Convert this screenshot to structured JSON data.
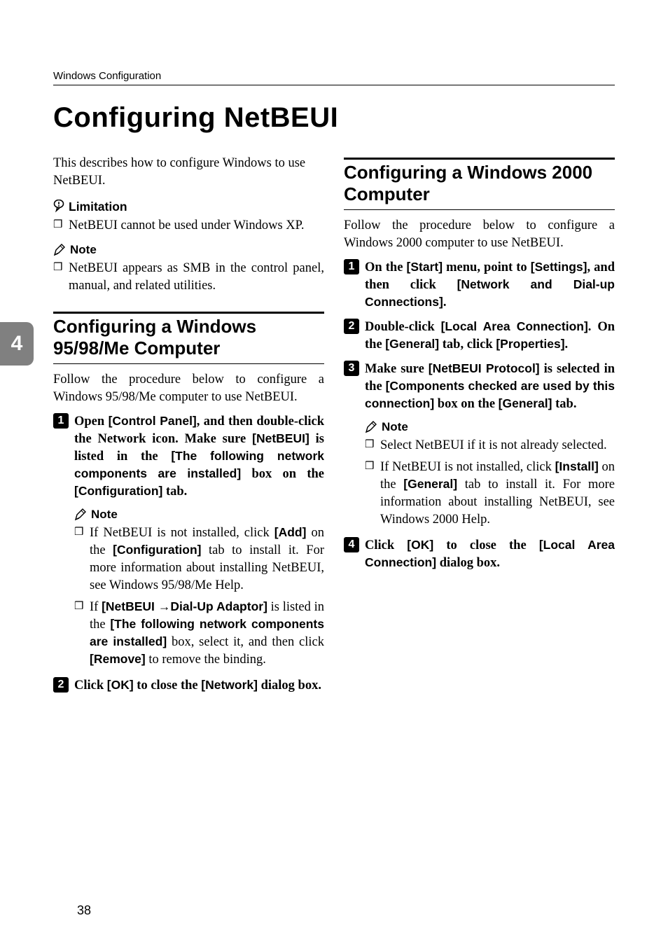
{
  "running_head": "Windows Configuration",
  "title": "Configuring NetBEUI",
  "chapter_tab": "4",
  "page_number": "38",
  "left": {
    "intro": "This describes how to configure Windows to use NetBEUI.",
    "limitation_label": "Limitation",
    "limitation_item": "NetBEUI cannot be used under Windows XP.",
    "note_label": "Note",
    "note_item": "NetBEUI appears as SMB in the control panel, manual, and related utilities.",
    "section_heading": "Configuring a Windows 95/98/Me Computer",
    "section_intro": "Follow the procedure below to configure a Windows 95/98/Me computer to use NetBEUI.",
    "step1": {
      "pre1": "Open ",
      "ui1": "[Control Panel]",
      "mid1": ", and then double-click the Network icon. Make sure ",
      "ui2": "[NetBEUI]",
      "mid2": " is listed in the ",
      "ui3": "[The following network components are installed]",
      "mid3": " box on the ",
      "ui4": "[Configuration]",
      "post": " tab."
    },
    "step1_note_label": "Note",
    "step1_note1": {
      "pre": "If NetBEUI is not installed, click ",
      "ui1": "[Add]",
      "mid1": " on the ",
      "ui2": "[Configuration]",
      "post": " tab to install it. For more information about installing NetBEUI, see Windows 95/98/Me Help."
    },
    "step1_note2": {
      "pre": "If ",
      "ui1": "[NetBEUI →Dial-Up Adaptor]",
      "mid1": " is listed in the ",
      "ui2": "[The following network components are installed]",
      "mid2": " box, select it, and then click ",
      "ui3": "[Remove]",
      "post": " to remove the binding."
    },
    "step2": {
      "pre": "Click ",
      "ui1": "[OK]",
      "mid1": " to close the ",
      "ui2": "[Network]",
      "post": " dialog box."
    }
  },
  "right": {
    "section_heading": "Configuring a Windows 2000 Computer",
    "section_intro": "Follow the procedure below to configure a Windows 2000 computer to use NetBEUI.",
    "step1": {
      "pre": "On the ",
      "ui1": "[Start]",
      "mid1": " menu, point to ",
      "ui2": "[Settings]",
      "mid2": ", and then click ",
      "ui3": "[Network and Dial-up Connections]",
      "post": "."
    },
    "step2": {
      "pre": "Double-click ",
      "ui1": "[Local Area Connection]",
      "mid1": ". On the ",
      "ui2": "[General]",
      "mid2": " tab, click ",
      "ui3": "[Properties]",
      "post": "."
    },
    "step3": {
      "pre": "Make sure ",
      "ui1": "[NetBEUI Protocol]",
      "mid1": " is selected in the ",
      "ui2": "[Components checked are used by this connection]",
      "mid2": " box on the ",
      "ui3": "[General]",
      "post": " tab."
    },
    "note_label": "Note",
    "note1": "Select NetBEUI if it is not already selected.",
    "note2": {
      "pre": "If NetBEUI is not installed, click ",
      "ui1": "[Install]",
      "mid1": " on the ",
      "ui2": "[General]",
      "post": " tab to install it. For more information about installing NetBEUI, see Windows 2000 Help."
    },
    "step4": {
      "pre": "Click ",
      "ui1": "[OK]",
      "mid1": " to close the ",
      "ui2": "[Local Area Connection]",
      "post": " dialog box."
    }
  }
}
